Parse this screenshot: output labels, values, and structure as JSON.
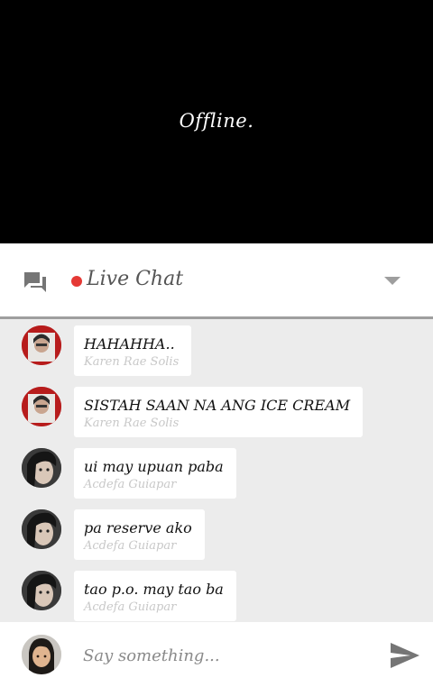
{
  "video": {
    "status": "Offline."
  },
  "chat": {
    "title": "Live Chat"
  },
  "messages": [
    {
      "text": "HAHAHHA..",
      "author": "Karen Rae Solis"
    },
    {
      "text": "SISTAH SAAN NA ANG ICE CREAM",
      "author": "Karen Rae Solis"
    },
    {
      "text": "ui may upuan paba",
      "author": "Acdefa Guiapar"
    },
    {
      "text": "pa reserve ako",
      "author": "Acdefa Guiapar"
    },
    {
      "text": "tao p.o. may tao ba",
      "author": "Acdefa Guiapar"
    }
  ],
  "composer": {
    "placeholder": "Say something..."
  },
  "colors": {
    "live": "#e53935",
    "icons": "#757575",
    "header_divider": "#9e9e9e",
    "background": "#ececec"
  },
  "icons": {
    "chat": "chat-bubbles-icon",
    "collapse": "caret-down-icon",
    "send": "send-icon"
  }
}
